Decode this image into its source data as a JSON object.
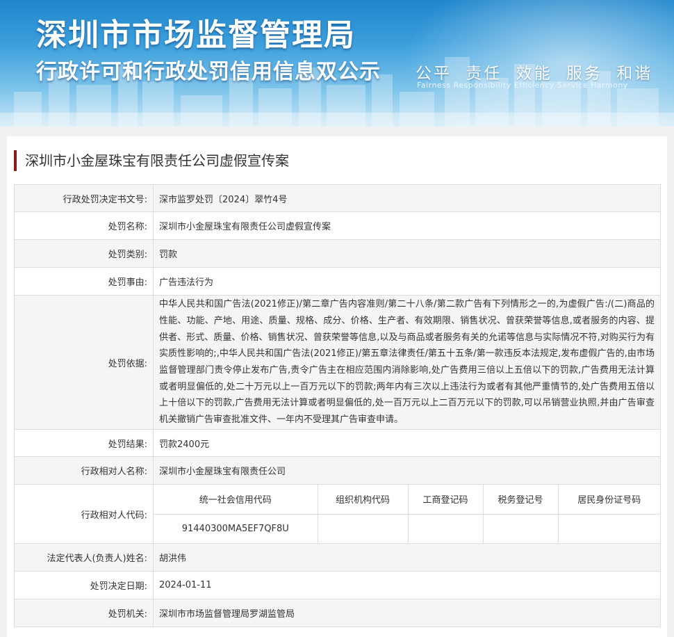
{
  "banner": {
    "title": "深圳市市场监督管理局",
    "subtitle": "行政许可和行政处罚信用信息双公示",
    "slogan": "公平 责任 效能 服务 和谐",
    "slogan_en": "Fairness Responsibility Efficiency Service Harmony"
  },
  "case_title": "深圳市小金屋珠宝有限责任公司虚假宣传案",
  "rows": {
    "decision_no": {
      "label": "行政处罚决定书文号:",
      "value": "深市监罗处罚〔2024〕翠竹4号"
    },
    "penalty_name": {
      "label": "处罚名称:",
      "value": "深圳市小金屋珠宝有限责任公司虚假宣传案"
    },
    "penalty_type": {
      "label": "处罚类别:",
      "value": "罚款"
    },
    "penalty_reason": {
      "label": "处罚事由:",
      "value": "广告违法行为"
    },
    "penalty_basis": {
      "label": "处罚依据:",
      "value": "中华人民共和国广告法(2021修正)/第二章广告内容准则/第二十八条/第二款广告有下列情形之一的,为虚假广告:/(二)商品的性能、功能、产地、用途、质量、规格、成分、价格、生产者、有效期限、销售状况、曾获荣誉等信息,或者服务的内容、提供者、形式、质量、价格、销售状况、曾获荣誉等信息,以及与商品或者服务有关的允诺等信息与实际情况不符,对购买行为有实质性影响的;,中华人民共和国广告法(2021修正)/第五章法律责任/第五十五条/第一款违反本法规定,发布虚假广告的,由市场监督管理部门责令停止发布广告,责令广告主在相应范围内消除影响,处广告费用三倍以上五倍以下的罚款,广告费用无法计算或者明显偏低的,处二十万元以上一百万元以下的罚款;两年内有三次以上违法行为或者有其他严重情节的,处广告费用五倍以上十倍以下的罚款,广告费用无法计算或者明显偏低的,处一百万元以上二百万元以下的罚款,可以吊销营业执照,并由广告审查机关撤销广告审查批准文件、一年内不受理其广告审查申请。"
    },
    "penalty_result": {
      "label": "处罚结果:",
      "value": "罚款2400元"
    },
    "party_name": {
      "label": "行政相对人名称:",
      "value": "深圳市小金屋珠宝有限责任公司"
    },
    "party_code": {
      "label": "行政相对人代码:",
      "headers": [
        "统一社会信用代码",
        "组织机构代码",
        "工商登记码",
        "税务登记号",
        "居民身份证号码"
      ],
      "values": [
        "91440300MA5EF7QF8U",
        "",
        "",
        "",
        ""
      ]
    },
    "legal_rep": {
      "label": "法定代表人(负责人)姓名:",
      "value": "胡洪伟"
    },
    "decision_date": {
      "label": "处罚决定日期:",
      "value": "2024-01-11"
    },
    "authority": {
      "label": "处罚机关:",
      "value": "深圳市市场监督管理局罗湖监管局"
    }
  }
}
